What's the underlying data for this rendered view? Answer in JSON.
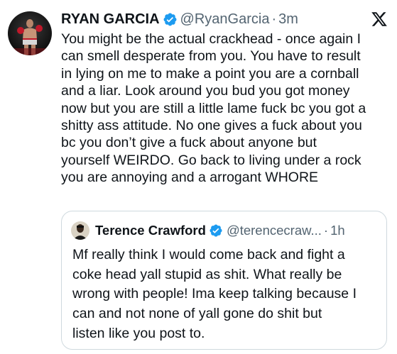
{
  "tweet": {
    "author_name": "RYAN GARCIA",
    "handle": "@RyanGarcia",
    "separator": "·",
    "time": "3m",
    "verified_icon": "verified-badge-icon",
    "platform_icon": "x-logo-icon",
    "text": "You might be the actual crackhead - once again I\ncan smell desperate from you. You have to result\nin lying on me to make a point you are a cornball\nand a liar. Look around you bud you got money\nnow but you are still a little lame fuck bc you got a\nshitty ass attitude. No one gives a fuck about you\nbc you don’t give a fuck about anyone but\nyourself WEIRDO. Go back to living under a rock\nyou are annoying and a arrogant WHORE"
  },
  "quoted_tweet": {
    "author_name": "Terence Crawford",
    "handle": "@terencecraw...",
    "separator": "·",
    "time": "1h",
    "verified_icon": "verified-badge-icon",
    "text": "Mf really think I would come back and fight a\ncoke head yall stupid as shit. What really be\nwrong with people! Ima keep talking because I\ncan and not none of yall gone do shit but\nlisten like you post to."
  },
  "colors": {
    "text_primary": "#0f1419",
    "text_secondary": "#536471",
    "verified_blue": "#1d9bf0",
    "border": "#cfd9de"
  }
}
